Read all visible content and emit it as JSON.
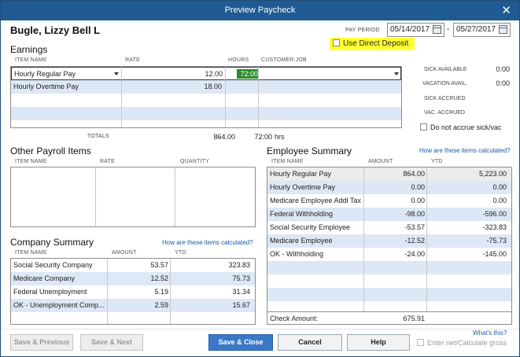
{
  "window": {
    "title": "Preview Paycheck",
    "close_glyph": "✕"
  },
  "employee_name": "Bugle, Lizzy Bell L",
  "pay_period": {
    "label": "PAY PERIOD",
    "start": "05/14/2017",
    "separator": "-",
    "end": "05/27/2017"
  },
  "direct_deposit": {
    "label": "Use Direct Deposit",
    "checked": false
  },
  "earnings": {
    "title": "Earnings",
    "columns": [
      "ITEM NAME",
      "RATE",
      "HOURS",
      "CUSTOMER:JOB"
    ],
    "rows": [
      {
        "item": "Hourly Regular Pay",
        "rate": "12.00",
        "hours": "72:00",
        "job": ""
      },
      {
        "item": "Hourly Overtime Pay",
        "rate": "18.00",
        "hours": "",
        "job": ""
      }
    ],
    "totals_label": "TOTALS",
    "total_amount": "864.00",
    "total_hours": "72:00",
    "hours_unit": "hrs"
  },
  "sick_vac": {
    "sick_available_label": "SICK AVAILABLE",
    "sick_available": "0:00",
    "vac_avail_label": "VACATION AVAIL.",
    "vac_avail": "0:00",
    "sick_accrued_label": "SICK ACCRUED",
    "vac_accrued_label": "VAC. ACCRUED",
    "no_accrue_label": "Do not accrue sick/vac"
  },
  "other_payroll": {
    "title": "Other Payroll Items",
    "columns": [
      "ITEM NAME",
      "RATE",
      "QUANTITY"
    ]
  },
  "employee_summary": {
    "title": "Employee Summary",
    "help_link": "How are these items calculated?",
    "columns": [
      "ITEM NAME",
      "AMOUNT",
      "YTD"
    ],
    "rows": [
      {
        "item": "Hourly Regular Pay",
        "amount": "864.00",
        "ytd": "5,223.00"
      },
      {
        "item": "Hourly Overtime Pay",
        "amount": "0.00",
        "ytd": "0.00"
      },
      {
        "item": "Medicare Employee Addl Tax",
        "amount": "0.00",
        "ytd": "0.00"
      },
      {
        "item": "Federal Withholding",
        "amount": "-98.00",
        "ytd": "-596.00"
      },
      {
        "item": "Social Security Employee",
        "amount": "-53.57",
        "ytd": "-323.83"
      },
      {
        "item": "Medicare Employee",
        "amount": "-12.52",
        "ytd": "-75.73"
      },
      {
        "item": "OK - Withholding",
        "amount": "-24.00",
        "ytd": "-145.00"
      }
    ],
    "check_amount_label": "Check Amount:",
    "check_amount": "675.91"
  },
  "company_summary": {
    "title": "Company Summary",
    "help_link": "How are these items calculated?",
    "columns": [
      "ITEM NAME",
      "AMOUNT",
      "YTD"
    ],
    "rows": [
      {
        "item": "Social Security Company",
        "amount": "53.57",
        "ytd": "323.83"
      },
      {
        "item": "Medicare Company",
        "amount": "12.52",
        "ytd": "75.73"
      },
      {
        "item": "Federal Unemployment",
        "amount": "5.19",
        "ytd": "31.34"
      },
      {
        "item": "OK - Unemployment Comp...",
        "amount": "2.59",
        "ytd": "15.67"
      }
    ]
  },
  "footer": {
    "save_previous": "Save & Previous",
    "save_next": "Save & Next",
    "save_close": "Save & Close",
    "cancel": "Cancel",
    "help": "Help",
    "whats_this": "What's this?",
    "enter_net": "Enter net/Calculate gross"
  },
  "colors": {
    "titlebar": "#1f5a93",
    "accent": "#3a78c8",
    "highlight": "#ffff33",
    "row_alt": "#dde7f5",
    "hours_cell": "#2e8b2e"
  }
}
